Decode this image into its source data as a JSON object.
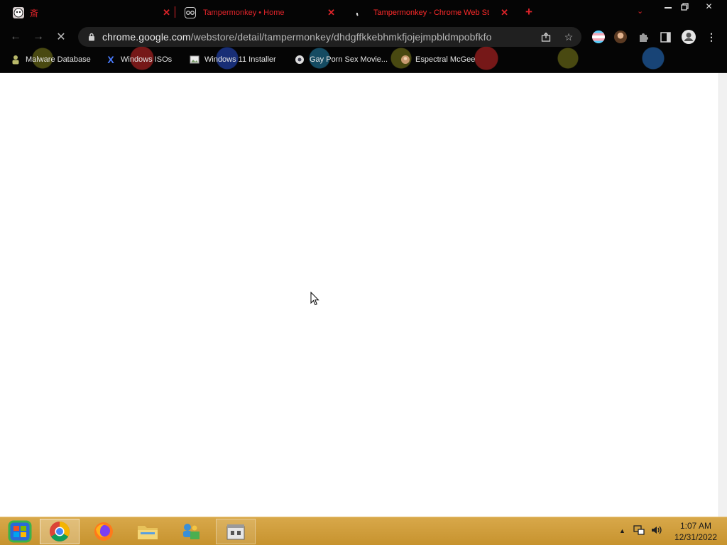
{
  "browser": {
    "tabs": [
      {
        "title": "",
        "icon": "red-glyph-favicon"
      },
      {
        "title": "Tampermonkey • Home",
        "icon": "tampermonkey-favicon"
      },
      {
        "title": "Tampermonkey - Chrome Web St",
        "icon": "loading-favicon",
        "active": true
      }
    ],
    "new_tab_label": "+",
    "tab_search_label": "⌄",
    "window_controls": {
      "minimize": "—",
      "restore": "❐",
      "close": "✕"
    },
    "accent_color": "#e0242a"
  },
  "toolbar": {
    "back_label": "←",
    "forward_label": "→",
    "stop_label": "✕",
    "url_host": "chrome.google.com",
    "url_path": "/webstore/detail/tampermonkey/dhdgffkkebhmkfjojejmpbldmpobfkfo",
    "share_label": "⇪",
    "bookmark_star_label": "☆",
    "menu_label": "⋮"
  },
  "bookmarks": [
    {
      "label": "Malware Database",
      "icon": "person-icon"
    },
    {
      "label": "Windows ISOs",
      "icon": "x-logo-icon"
    },
    {
      "label": "Windows 11 Installer",
      "icon": "image-icon"
    },
    {
      "label": "Gay Porn Sex Movie...",
      "icon": "globe-icon"
    },
    {
      "label": "Espectral McGee",
      "icon": "avatar-icon"
    }
  ],
  "taskbar": {
    "apps": [
      {
        "name": "start",
        "icon": "windows-start-icon"
      },
      {
        "name": "chrome",
        "icon": "chrome-icon",
        "active": true
      },
      {
        "name": "firefox",
        "icon": "firefox-icon"
      },
      {
        "name": "file-explorer",
        "icon": "folder-icon"
      },
      {
        "name": "network",
        "icon": "network-icon"
      },
      {
        "name": "store",
        "icon": "store-icon",
        "pinned": true
      }
    ],
    "tray": {
      "show_hidden_label": "▲",
      "network_label": "🖧",
      "volume_label": "🔊"
    },
    "time": "1:07 AM",
    "date": "12/31/2022",
    "color": "#c9962f"
  }
}
